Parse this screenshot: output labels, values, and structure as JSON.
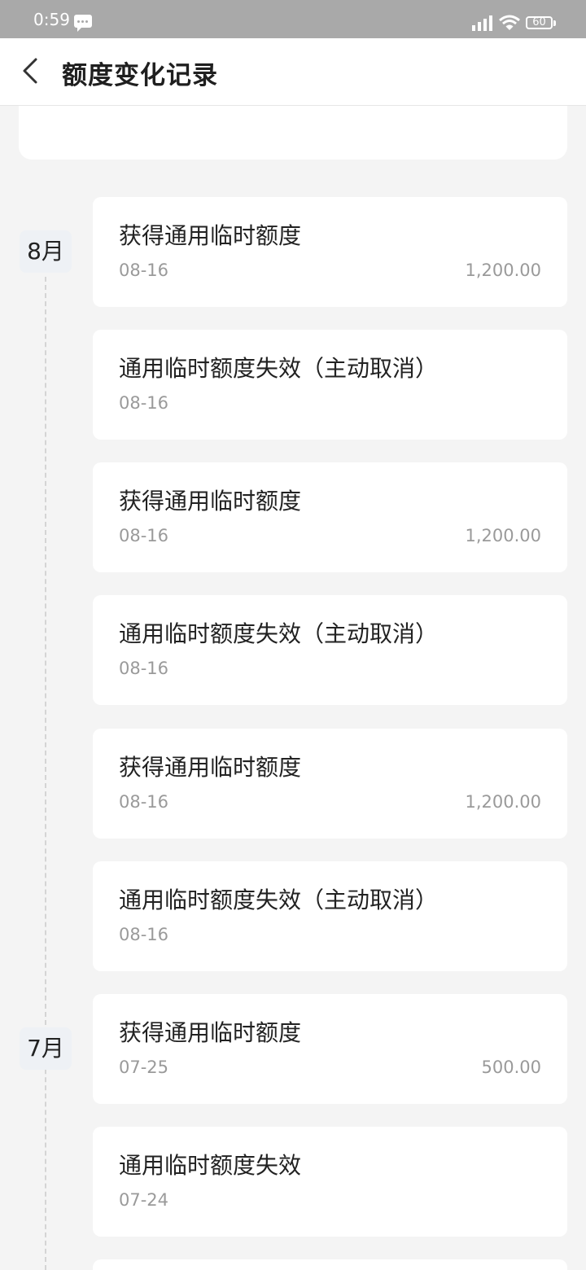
{
  "status_bar": {
    "time": "0:59",
    "battery": "60"
  },
  "header": {
    "title": "额度变化记录"
  },
  "months": [
    {
      "label": "8月"
    },
    {
      "label": "7月"
    }
  ],
  "records": [
    {
      "title": "获得通用临时额度",
      "date": "08-16",
      "amount": "1,200.00"
    },
    {
      "title": "通用临时额度失效（主动取消）",
      "date": "08-16",
      "amount": ""
    },
    {
      "title": "获得通用临时额度",
      "date": "08-16",
      "amount": "1,200.00"
    },
    {
      "title": "通用临时额度失效（主动取消）",
      "date": "08-16",
      "amount": ""
    },
    {
      "title": "获得通用临时额度",
      "date": "08-16",
      "amount": "1,200.00"
    },
    {
      "title": "通用临时额度失效（主动取消）",
      "date": "08-16",
      "amount": ""
    },
    {
      "title": "获得通用临时额度",
      "date": "07-25",
      "amount": "500.00"
    },
    {
      "title": "通用临时额度失效",
      "date": "07-24",
      "amount": ""
    }
  ]
}
